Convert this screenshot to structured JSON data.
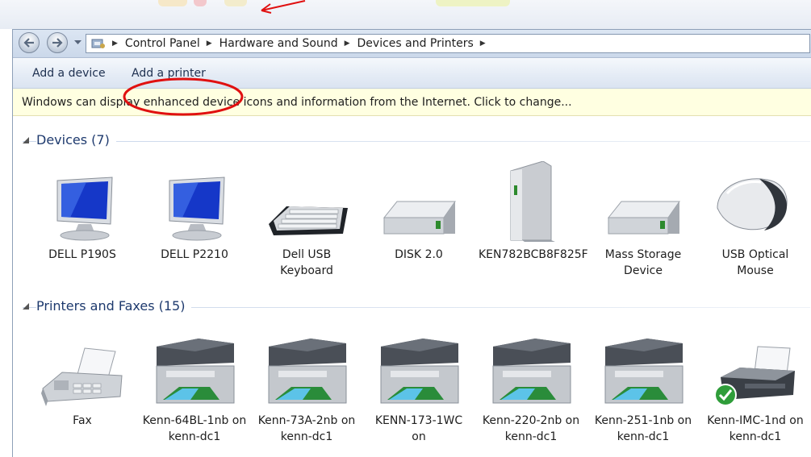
{
  "breadcrumb": {
    "items": [
      "Control Panel",
      "Hardware and Sound",
      "Devices and Printers"
    ]
  },
  "toolbar": {
    "add_device": "Add a device",
    "add_printer": "Add a printer"
  },
  "infobar": {
    "message": "Windows can display enhanced device icons and information from the Internet. Click to change..."
  },
  "devices": {
    "title": "Devices (7)",
    "items": [
      {
        "label": "DELL P190S",
        "icon": "monitor-icon"
      },
      {
        "label": "DELL P2210",
        "icon": "monitor-icon"
      },
      {
        "label": "Dell USB Keyboard",
        "icon": "keyboard-icon"
      },
      {
        "label": "DISK 2.0",
        "icon": "drive-icon"
      },
      {
        "label": "KEN782BCB8F825F",
        "icon": "tower-drive-icon"
      },
      {
        "label": "Mass Storage Device",
        "icon": "drive-icon"
      },
      {
        "label": "USB Optical Mouse",
        "icon": "mouse-icon"
      }
    ]
  },
  "printers": {
    "title": "Printers and Faxes (15)",
    "items": [
      {
        "label": "Fax",
        "icon": "fax-icon"
      },
      {
        "label": "Kenn-64BL-1nb on kenn-dc1",
        "icon": "mfp-printer-icon"
      },
      {
        "label": "Kenn-73A-2nb on kenn-dc1",
        "icon": "mfp-printer-icon"
      },
      {
        "label": "KENN-173-1WC on",
        "icon": "mfp-printer-icon"
      },
      {
        "label": "Kenn-220-2nb on kenn-dc1",
        "icon": "mfp-printer-icon"
      },
      {
        "label": "Kenn-251-1nb on kenn-dc1",
        "icon": "mfp-printer-icon"
      },
      {
        "label": "Kenn-IMC-1nd on kenn-dc1",
        "icon": "default-printer-icon"
      }
    ]
  },
  "colors": {
    "annotation": "#e01010",
    "group_title": "#1e3a6e",
    "infobar_bg": "#ffffe1"
  }
}
